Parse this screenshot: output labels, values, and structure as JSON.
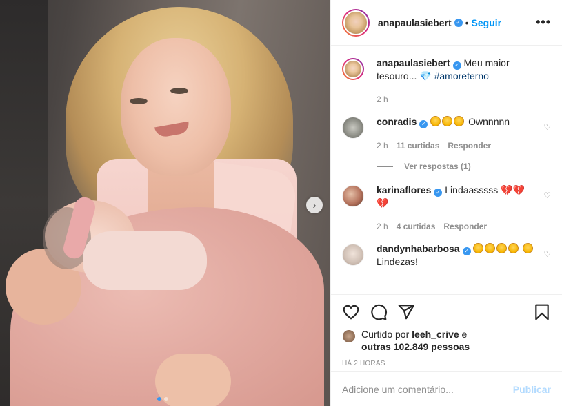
{
  "post": {
    "author": "anapaulasiebert",
    "verified_symbol": "✓",
    "separator": "•",
    "follow_label": "Seguir",
    "more_label": "•••"
  },
  "caption": {
    "author": "anapaulasiebert",
    "text": "Meu maior tesouro... ",
    "emoji": "💎",
    "hashtag": "#amoreterno",
    "age": "2 h"
  },
  "comments": [
    {
      "author": "conradis",
      "text": "Ownnnnn",
      "emoji_count": 3,
      "age": "2 h",
      "likes": "11 curtidas",
      "reply_label": "Responder",
      "view_replies": "Ver respostas (1)"
    },
    {
      "author": "karinaflores",
      "text": "Lindaasssss",
      "emoji": "💔",
      "age": "2 h",
      "likes": "4 curtidas",
      "reply_label": "Responder"
    },
    {
      "author": "dandynhabarbosa",
      "text": "Lindezas!",
      "emoji_count": 5
    }
  ],
  "actions": {
    "like_icon": "heart-icon",
    "comment_icon": "comment-icon",
    "share_icon": "share-icon",
    "save_icon": "bookmark-icon"
  },
  "likes": {
    "prefix": "Curtido por ",
    "user": "leeh_crive",
    "middle": " e",
    "others": "outras 102.849 pessoas"
  },
  "timestamp": "HÁ 2 HORAS",
  "add_comment": {
    "placeholder": "Adicione um comentário...",
    "publish_label": "Publicar"
  },
  "carousel": {
    "next_label": "›",
    "slide_count": 2,
    "active_slide": 1
  },
  "colors": {
    "accent": "#0095f6",
    "verified": "#3897f0",
    "publish_disabled": "#b3dbff",
    "muted": "#8e8e8e"
  }
}
